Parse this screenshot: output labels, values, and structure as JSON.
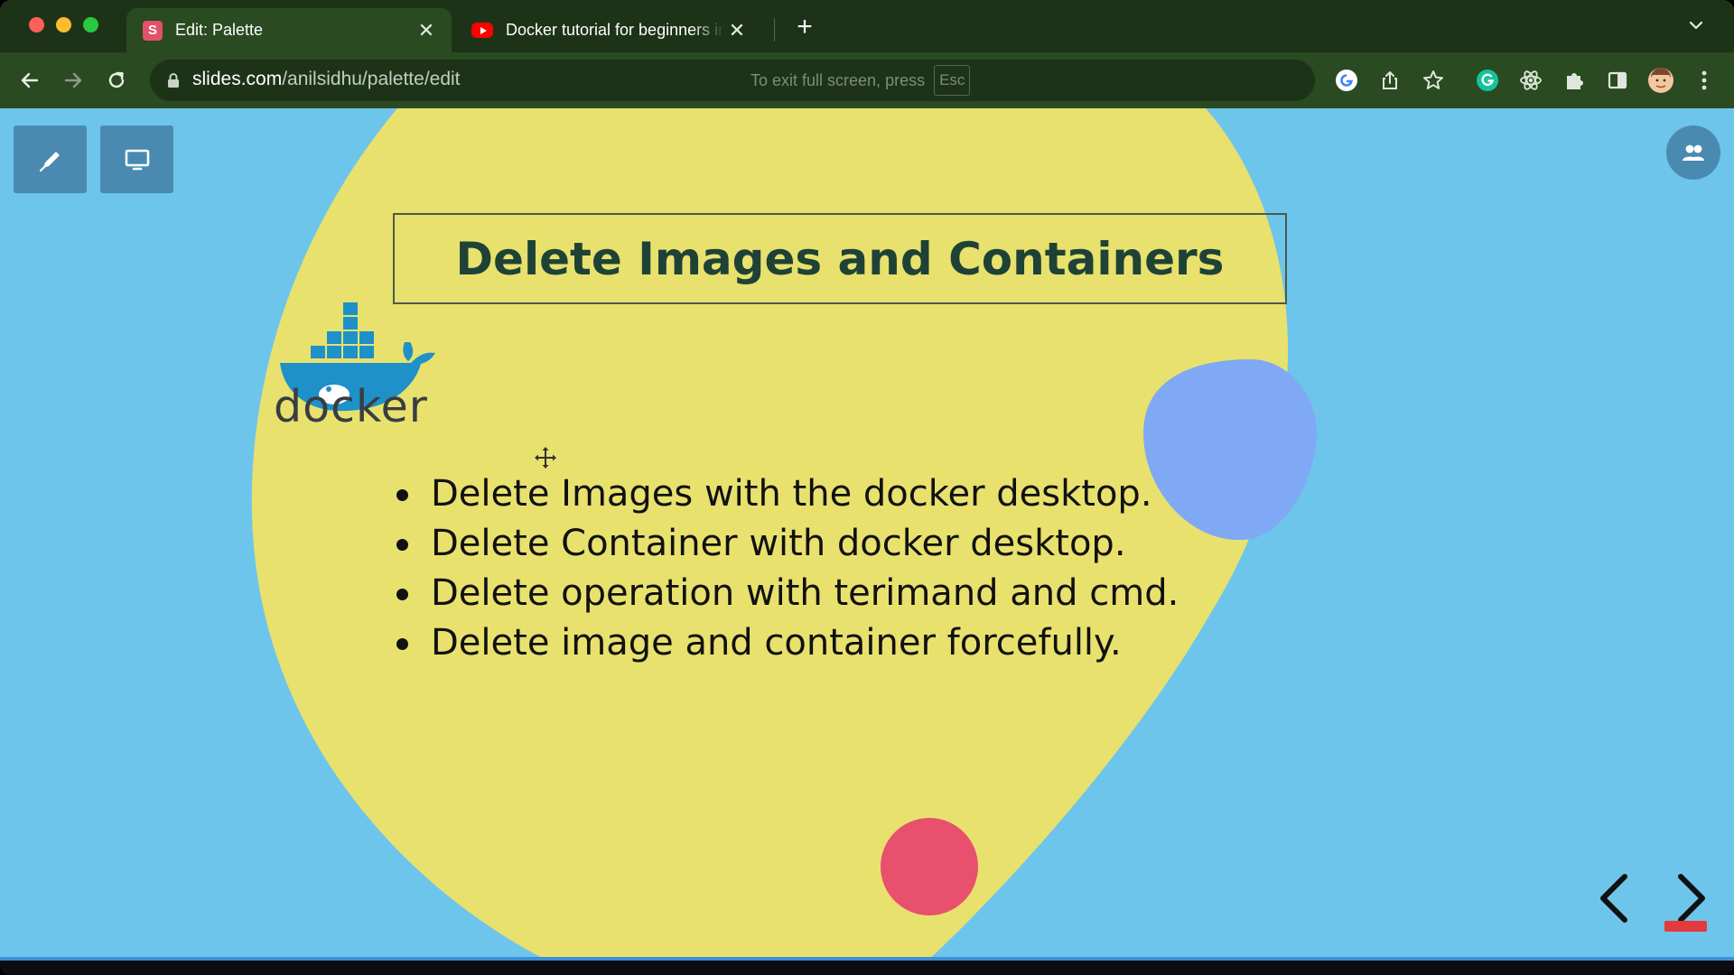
{
  "browser": {
    "tabs": [
      {
        "title": "Edit: Palette",
        "favicon": "S",
        "active": true
      },
      {
        "title": "Docker tutorial for beginners in",
        "favicon": "youtube-icon",
        "active": false
      }
    ],
    "url_host": "slides.com",
    "url_path": "/anilsidhu/palette/edit",
    "fullscreen_hint": "To exit full screen, press",
    "fullscreen_key": "Esc"
  },
  "colors": {
    "tab_strip": "#1d3318",
    "toolbar": "#2a4a22",
    "slide_background": "#6dc5eb",
    "blob_yellow": "#e8e16e",
    "blob_blue": "#7fa9f5",
    "blob_pink": "#e8506e",
    "title_text": "#1e4236",
    "docker_blue": "#1d91c8"
  },
  "slide": {
    "title": "Delete Images and Containers",
    "logo_text": "docker",
    "bullets": [
      "Delete Images with the docker desktop.",
      "Delete Container with docker desktop.",
      "Delete operation with terimand and cmd.",
      "Delete image and container forcefully."
    ]
  }
}
